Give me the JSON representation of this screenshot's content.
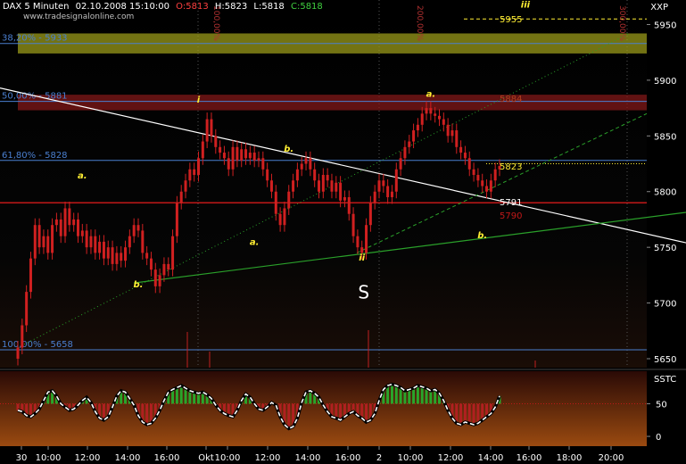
{
  "header": {
    "symbol": "DAX 5 Minuten",
    "timestamp": "02.10.2008 15:10:00",
    "open": "O:5813",
    "high": "H:5823",
    "low": "L:5818",
    "close": "C:5818",
    "watermark": "www.tradesignalonline.com"
  },
  "top_right_label": "XXP",
  "oscillator_label": "SSTC",
  "colors": {
    "background": "#000000",
    "candle": "#d02020",
    "trendline_white": "#ffffff",
    "support_green": "#2aa02a",
    "fib_blue": "#4a7fd0",
    "fib_red": "#a01818",
    "band_olive": "#9a9a1a",
    "band_red": "#8a1a1a",
    "annot_yellow": "#ffee33",
    "osc_green": "#2aa52a",
    "osc_red": "#b02020"
  },
  "chart_data": {
    "type": "candlestick",
    "price_axis": {
      "ylim": [
        5642,
        5972
      ],
      "ticks": [
        5650,
        5700,
        5750,
        5800,
        5850,
        5900,
        5950
      ]
    },
    "time_axis": {
      "ticks": [
        "30",
        "10:00",
        "12:00",
        "14:00",
        "16:00",
        "Okt",
        "10:00",
        "12:00",
        "14:00",
        "16:00",
        "2",
        "10:00",
        "12:00",
        "14:00",
        "16:00",
        "18:00",
        "20:00"
      ],
      "bars_between_ticks": 24
    },
    "close_series": [
      5660,
      5680,
      5710,
      5740,
      5770,
      5750,
      5760,
      5745,
      5770,
      5775,
      5760,
      5785,
      5770,
      5775,
      5760,
      5765,
      5750,
      5760,
      5745,
      5755,
      5740,
      5750,
      5735,
      5745,
      5738,
      5750,
      5760,
      5770,
      5765,
      5745,
      5740,
      5730,
      5715,
      5725,
      5735,
      5730,
      5760,
      5790,
      5800,
      5810,
      5820,
      5815,
      5830,
      5845,
      5865,
      5850,
      5840,
      5835,
      5830,
      5820,
      5840,
      5828,
      5838,
      5830,
      5835,
      5828,
      5830,
      5820,
      5810,
      5800,
      5780,
      5770,
      5785,
      5800,
      5810,
      5820,
      5825,
      5830,
      5820,
      5810,
      5800,
      5815,
      5810,
      5800,
      5808,
      5792,
      5795,
      5780,
      5760,
      5750,
      5745,
      5770,
      5790,
      5800,
      5810,
      5805,
      5795,
      5800,
      5820,
      5830,
      5840,
      5845,
      5855,
      5860,
      5870,
      5875,
      5870,
      5868,
      5865,
      5860,
      5850,
      5855,
      5840,
      5835,
      5830,
      5820,
      5815,
      5810,
      5805,
      5800,
      5810,
      5820,
      5823
    ],
    "fib_levels": [
      {
        "label": "38,20% - 5933",
        "value": 5933
      },
      {
        "label": "50,00% - 5881",
        "value": 5881
      },
      {
        "label": "61,80% - 5828",
        "value": 5828
      },
      {
        "label": "100,00% - 5658",
        "value": 5658
      }
    ],
    "horizontal_lines": [
      {
        "value": 5790,
        "label": "5790"
      },
      {
        "value": 5825,
        "label": ""
      },
      {
        "value": 5955,
        "label": "5955"
      }
    ],
    "bands": [
      {
        "from": 5924,
        "to": 5942
      },
      {
        "from": 5873,
        "to": 5887
      }
    ],
    "price_labels": [
      {
        "text": "5884",
        "value": 5884
      },
      {
        "text": "5823",
        "value": 5823
      },
      {
        "text": "5791",
        "value": 5791
      },
      {
        "text": "5955",
        "value": 5955
      }
    ],
    "extension_labels": [
      "100,00%",
      "200,00%",
      "300,00%"
    ],
    "wave_labels": [
      {
        "text": "a.",
        "bar": 15,
        "value": 5812
      },
      {
        "text": "i",
        "bar": 42,
        "value": 5880
      },
      {
        "text": "b.",
        "bar": 28,
        "value": 5714
      },
      {
        "text": "a.",
        "bar": 55,
        "value": 5752
      },
      {
        "text": "b.",
        "bar": 63,
        "value": 5836
      },
      {
        "text": "ii",
        "bar": 80,
        "value": 5738
      },
      {
        "text": "S",
        "bar": 80,
        "value": 5712
      },
      {
        "text": "a.",
        "bar": 96,
        "value": 5885
      },
      {
        "text": "b.",
        "bar": 108,
        "value": 5758
      },
      {
        "text": "iii",
        "bar": 118,
        "value": 5965
      }
    ],
    "oscillator": {
      "ticks": [
        50,
        0
      ],
      "ylim": [
        -15,
        100
      ],
      "values": [
        40,
        38,
        32,
        30,
        35,
        42,
        55,
        68,
        70,
        62,
        50,
        45,
        40,
        42,
        48,
        55,
        60,
        52,
        38,
        28,
        25,
        30,
        45,
        62,
        70,
        68,
        58,
        48,
        32,
        22,
        18,
        20,
        28,
        40,
        55,
        68,
        72,
        75,
        78,
        74,
        70,
        68,
        66,
        68,
        64,
        58,
        48,
        40,
        35,
        32,
        30,
        40,
        55,
        65,
        60,
        50,
        42,
        40,
        45,
        52,
        48,
        30,
        18,
        12,
        15,
        28,
        52,
        68,
        70,
        66,
        60,
        48,
        38,
        30,
        28,
        25,
        30,
        35,
        38,
        32,
        28,
        22,
        25,
        35,
        55,
        72,
        78,
        80,
        78,
        75,
        70,
        72,
        74,
        78,
        76,
        74,
        70,
        72,
        66,
        55,
        40,
        28,
        20,
        18,
        22,
        20,
        18,
        20,
        25,
        30,
        35,
        45,
        62
      ]
    }
  }
}
